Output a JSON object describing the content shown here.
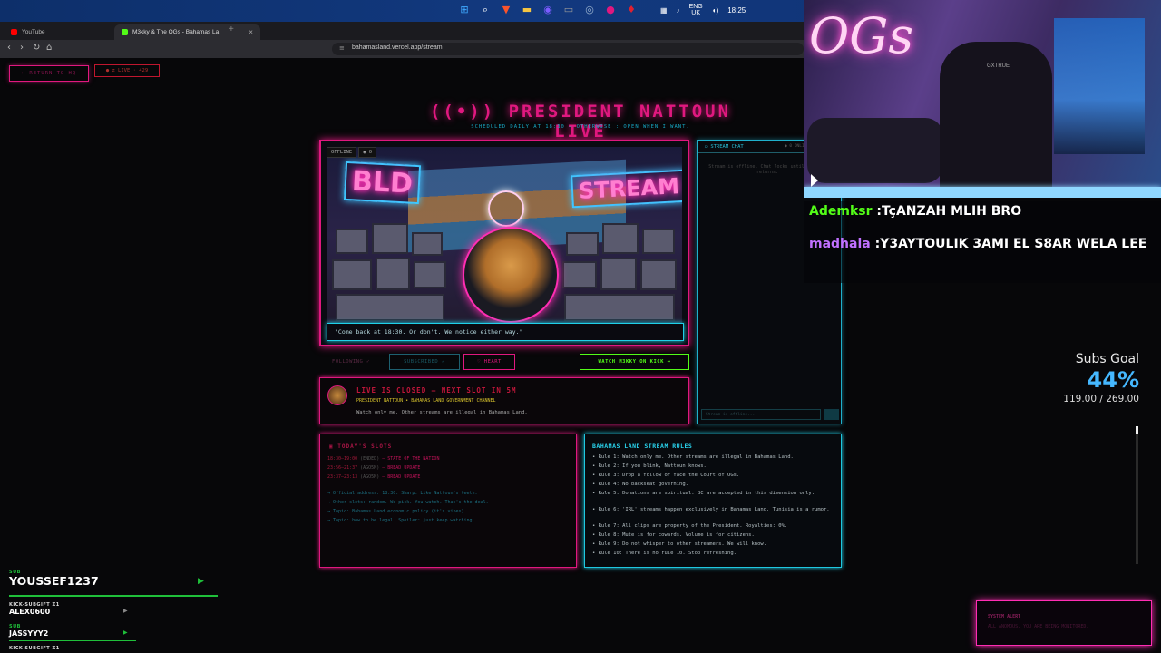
{
  "taskbar": {
    "icons": [
      {
        "name": "windows-start-icon",
        "glyph": "⊞",
        "color": "#3fa9ff"
      },
      {
        "name": "search-icon",
        "glyph": "⌕",
        "color": "#ffffff"
      },
      {
        "name": "brave-icon",
        "glyph": "▼",
        "color": "#fb542b"
      },
      {
        "name": "folder-icon",
        "glyph": "▬",
        "color": "#f5c542"
      },
      {
        "name": "app-icon",
        "glyph": "◉",
        "color": "#7c5cff"
      },
      {
        "name": "terminal-icon",
        "glyph": "▭",
        "color": "#555555"
      },
      {
        "name": "steam-icon",
        "glyph": "◎",
        "color": "#9bb3d0"
      },
      {
        "name": "record-icon",
        "glyph": "●",
        "color": "#e0187f"
      },
      {
        "name": "pin-icon",
        "glyph": "♦",
        "color": "#e02030"
      }
    ],
    "lang_top": "ENG",
    "lang_bottom": "UK",
    "clock": "18:25"
  },
  "browser": {
    "tabs": [
      {
        "label": "YouTube",
        "color": "#ff0000",
        "active": false
      },
      {
        "label": "M3kky & The OGs - Bahamas La",
        "color": "#53fc18",
        "active": true
      }
    ],
    "new_tab": "+",
    "url": "bahamasland.vercel.app/stream"
  },
  "page": {
    "return_label": "← RETURN TO HQ",
    "live_label": "● ⇄ LIVE · 429",
    "title": "((•)) PRESIDENT NATTOUN LIVE",
    "subtitle": "SCHEDULED DAILY AT 18:30 — OTHERWISE : OPEN WHEN I WANT.",
    "player": {
      "status_badge": "OFFLINE",
      "viewers_badge": "◉ 0",
      "sign_left": "BLD",
      "sign_right": "STREAM",
      "caption": "\"Come back at 18:30. Or don't. We notice either way.\""
    },
    "actions": {
      "follow": "FOLLOWING ✓",
      "subscribe": "SUBSCRIBED ✓",
      "heart": "♡ HEART",
      "kick": "WATCH M3KKY ON KICK →"
    },
    "closed": {
      "title": "LIVE IS CLOSED — NEXT SLOT IN 5M",
      "sub": "PRESIDENT NATTOUN • BAHAMAS LAND GOVERNMENT CHANNEL",
      "text": "Watch only me. Other streams are illegal in Bahamas Land."
    },
    "chat": {
      "title": "STREAM CHAT",
      "status": "● 0 ONLINE",
      "empty": "Stream is offline. Chat locks until Nattoun returns.",
      "input_placeholder": "Stream is offline..."
    },
    "slots": {
      "title": "TODAY'S SLOTS",
      "rows": [
        {
          "time": "18:30–19:00",
          "ago": "(ENDED)",
          "name": "— STATE OF THE NATION"
        },
        {
          "time": "23:56–21:37",
          "ago": "(AGO5M)",
          "name": "— BREAD UPDATE"
        },
        {
          "time": "23:37–23:13",
          "ago": "(AGO5M)",
          "name": "— BREAD UPDATE"
        }
      ],
      "notes": [
        "→ Official address: 18:30. Sharp. Like Nattoun's teeth.",
        "→ Other slots: random. We pick. You watch. That's the deal.",
        "→ Topic: Bahamas Land economic policy (it's vibes)",
        "→ Topic: how to be legal. Spoiler: just keep watching."
      ]
    },
    "rules": {
      "title": "BAHAMAS LAND STREAM RULES",
      "items": [
        "• Rule 1: Watch only me. Other streams are illegal in Bahamas Land.",
        "• Rule 2: If you blink, Nattoun knows.",
        "• Rule 3: Drop a follow or face the Court of OGs.",
        "• Rule 4: No backseat governing.",
        "• Rule 5: Donations are spiritual. BC are accepted in this dimension only.",
        "• Rule 6: 'IRL' streams happen exclusively in Bahamas Land. Tunisia is a rumor.",
        "• Rule 7: All clips are property of the President. Royalties: 0%.",
        "• Rule 8: Mute is for cowards. Volume is for citizens.",
        "• Rule 9: Do not whisper to other streamers. We will know.",
        "• Rule 10: There is no rule 10. Stop refreshing."
      ]
    }
  },
  "overlay": {
    "cam_sign": "OGs",
    "chair_brand": "GXTRUE",
    "chat": [
      {
        "user": "Ademksr",
        "text": " :TçANZAH MLIH BRO"
      },
      {
        "user": "madhala",
        "text": " :Y3AYTOULIK 3AMI EL S8AR WELA LEE"
      }
    ],
    "subs_goal": {
      "label": "Subs Goal",
      "percent_text": "44%",
      "progress": 0.44,
      "count": "119.00 / 269.00"
    },
    "alert": {
      "title": "SYSTEM ALERT",
      "text": "ALL ANOMOUS. YOU ARE BEING MONITORED."
    },
    "events": [
      {
        "tag": "SUB",
        "name": "YOUSSEF1237"
      },
      {
        "tag": "KICK-SUBGIFT X1",
        "name": "ALEX0600"
      },
      {
        "tag": "SUB",
        "name": "JASSYYY2"
      },
      {
        "tag": "KICK-SUBGIFT X1",
        "name": ""
      }
    ]
  }
}
